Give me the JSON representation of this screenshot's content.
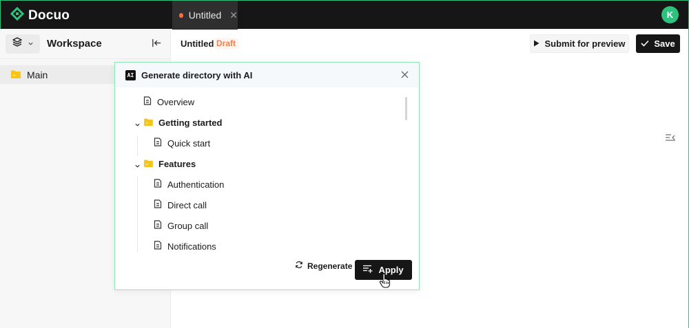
{
  "app": {
    "name": "Docuo",
    "brand_color": "#2ec27e"
  },
  "tabs": [
    {
      "label": "Untitled",
      "dot_color": "#ff6b3d",
      "close_icon": "close-icon"
    }
  ],
  "user": {
    "initial": "K",
    "avatar_color": "#2ec27e"
  },
  "sidebar": {
    "switcher_icon": "layers-icon",
    "title": "Workspace",
    "collapse_icon": "collapse-left-icon",
    "items": [
      {
        "label": "Main",
        "icon": "folder-icon",
        "selected": true
      }
    ]
  },
  "document": {
    "title": "Untitled",
    "status": "Draft",
    "status_color": "#ff7a45"
  },
  "toolbar": {
    "preview_label": "Submit for preview",
    "save_label": "Save"
  },
  "ai_panel": {
    "badge": "AI",
    "title": "Generate directory with AI",
    "tree": [
      {
        "type": "doc",
        "label": "Overview",
        "depth": 0
      },
      {
        "type": "folder",
        "label": "Getting started",
        "depth": 0,
        "expanded": true
      },
      {
        "type": "doc",
        "label": "Quick start",
        "depth": 1
      },
      {
        "type": "folder",
        "label": "Features",
        "depth": 0,
        "expanded": true
      },
      {
        "type": "doc",
        "label": "Authentication",
        "depth": 1
      },
      {
        "type": "doc",
        "label": "Direct call",
        "depth": 1
      },
      {
        "type": "doc",
        "label": "Group call",
        "depth": 1
      },
      {
        "type": "doc",
        "label": "Notifications",
        "depth": 1
      }
    ],
    "regenerate_label": "Regenerate",
    "apply_label": "Apply"
  }
}
